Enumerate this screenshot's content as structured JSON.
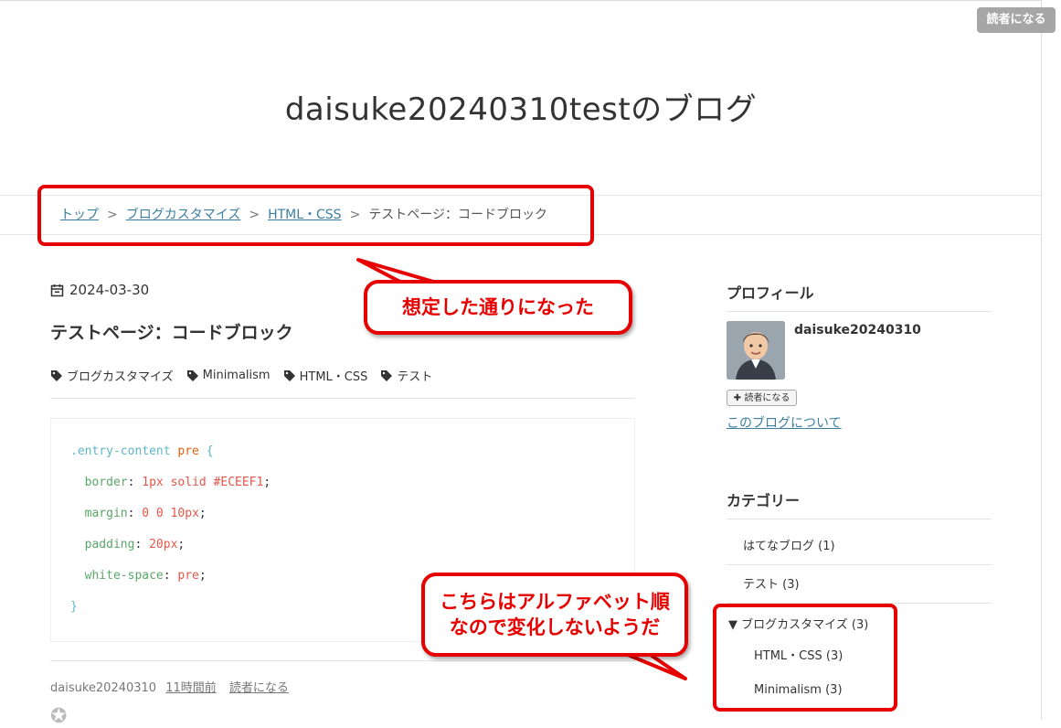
{
  "header": {
    "reader_button": "読者になる",
    "blog_title": "daisuke20240310testのブログ"
  },
  "breadcrumb": {
    "items": [
      "トップ",
      "ブログカスタマイズ",
      "HTML・CSS"
    ],
    "current": "テストページ：コードブロック",
    "separator": ">"
  },
  "post": {
    "date": "2024-03-30",
    "title": "テストページ：コードブロック",
    "tags": [
      "ブログカスタマイズ",
      "Minimalism",
      "HTML・CSS",
      "テスト"
    ],
    "code": {
      "selector": ".entry-content",
      "element": "pre",
      "open_brace": "{",
      "close_brace": "}",
      "rules": [
        {
          "prop": "border",
          "value": "1px solid #ECEEF1"
        },
        {
          "prop": "margin",
          "value": "0 0 10px"
        },
        {
          "prop": "padding",
          "value": "20px"
        },
        {
          "prop": "white-space",
          "value": "pre"
        }
      ]
    },
    "footer": {
      "author": "daisuke20240310",
      "time": "11時間前",
      "reader_link": "読者になる"
    }
  },
  "sidebar": {
    "profile": {
      "heading": "プロフィール",
      "name": "daisuke20240310",
      "reader_button": "読者になる",
      "about_link": "このブログについて"
    },
    "categories": {
      "heading": "カテゴリー",
      "items": [
        "はてなブログ (1)",
        "テスト (3)"
      ],
      "expanded": {
        "label": "ブログカスタマイズ (3)",
        "children": [
          "HTML・CSS (3)",
          "Minimalism (3)"
        ]
      }
    }
  },
  "annotations": {
    "callout_top": "想定した通りになった",
    "callout_bottom_line1": "こちらはアルファベット順",
    "callout_bottom_line2": "なので変化しないようだ",
    "accent_color": "#e60000"
  }
}
